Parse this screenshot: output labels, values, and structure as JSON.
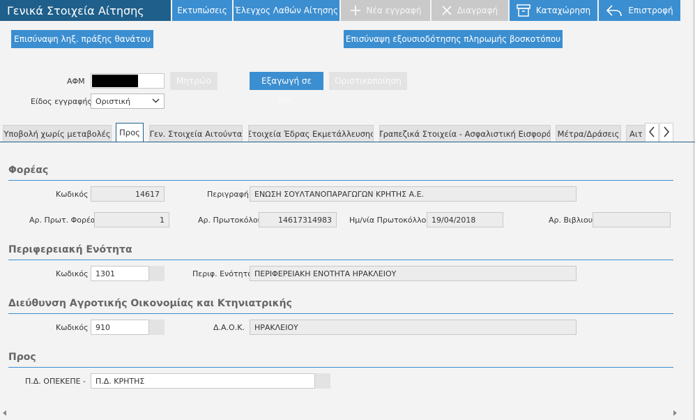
{
  "header": {
    "title": "Γενικά Στοιχεία Αίτησης",
    "print": "Εκτυπώσεις",
    "error_check": "Έλεγχος Λαθών Αίτησης",
    "new_record": "Νέα εγγραφή",
    "delete": "Διαγραφή",
    "save": "Καταχώρηση",
    "back": "Επιστροφή"
  },
  "actions": {
    "death_cert": "Επισύναψη ληξ. πράξης θανάτου",
    "pasture_auth": "Επισύναψη εξουσιοδότησης πληρωμής βοσκοτόπου"
  },
  "form": {
    "afm_label": "ΑΦΜ",
    "afm_value": "",
    "registry_button": "Μητρώο",
    "record_type_label": "Είδος εγγραφής",
    "record_type_value": "Οριστική",
    "export_button_line1": "Εξαγωγή σε",
    "export_button_line2": "XML",
    "finalize_button": "Οριστικοποίηση"
  },
  "tabs": [
    "Υποβολή χωρίς μεταβολές",
    "Προς",
    "Γεν. Στοιχεία Αιτούντα",
    "Στοιχεία Έδρας Εκμετάλλευσης",
    "Τραπεζικά Στοιχεία - Ασφαλιστική Εισφορά",
    "Μέτρα/Δράσεις",
    "Αιτ"
  ],
  "foreas": {
    "title": "Φορέας",
    "code_label": "Κωδικός",
    "code_value": "14617",
    "desc_label": "Περιγραφή",
    "desc_value": "ΕΝΩΣΗ ΣΟΥΛΤΑΝΟΠΑΡΑΓΩΓΩΝ ΚΡΗΤΗΣ Α.Ε.",
    "prot_foreas_label": "Αρ. Πρωτ. Φορέα",
    "prot_foreas_value": "1",
    "protocol_label": "Αρ. Πρωτοκόλου",
    "protocol_value": "14617314983",
    "protocol_date_label": "Ημ/νία Πρωτοκόλλου",
    "protocol_date_value": "19/04/2018",
    "book_label": "Αρ. Βιβλιου",
    "book_value": ""
  },
  "regional": {
    "title": "Περιφερειακή Ενότητα",
    "code_label": "Κωδικός",
    "code_value": "1301",
    "unit_label": "Περιφ. Ενότητα",
    "unit_value": "ΠΕΡΙΦΕΡΕΙΑΚΗ ΕΝΟΤΗΤΑ ΗΡΑΚΛΕΙΟΥ"
  },
  "daok": {
    "title": "Διεύθυνση Αγροτικής Οικονομίας και Κτηνιατρικής",
    "code_label": "Κωδικός",
    "code_value": "910",
    "name_label": "Δ.Α.Ο.Κ.",
    "name_value": "ΗΡΑΚΛΕΙΟΥ"
  },
  "pros": {
    "title": "Προς",
    "opekepe_label": "Π.Δ. ΟΠΕΚΕΠΕ -",
    "opekepe_value": "Π.Δ. ΚΡΗΤΗΣ"
  },
  "colors": {
    "title_bar": "#1f5f8b",
    "accent": "#3b8ed0",
    "disabled": "#c9c9c9"
  }
}
